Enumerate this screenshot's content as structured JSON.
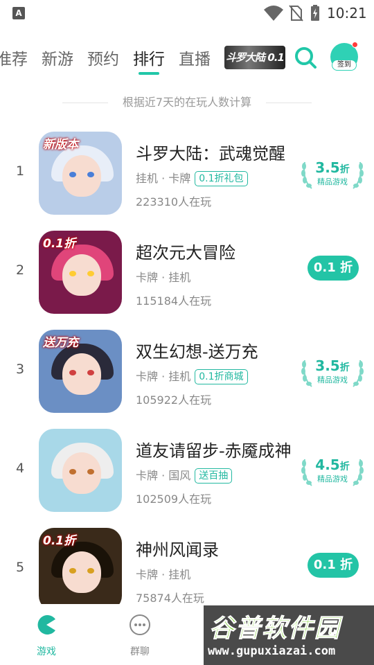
{
  "status_bar": {
    "app_indicator": "A",
    "time": "10:21"
  },
  "tabs": [
    {
      "label": "推荐",
      "partial": "准荐"
    },
    {
      "label": "新游"
    },
    {
      "label": "预约"
    },
    {
      "label": "排行",
      "active": true
    },
    {
      "label": "直播"
    }
  ],
  "tab_banner": {
    "text": "斗罗大陆 0.1"
  },
  "signin": {
    "label": "签到"
  },
  "note": "根据近7天的在玩人数计算",
  "games": [
    {
      "rank": "1",
      "title": "斗罗大陆：武魂觉醒",
      "categories": "挂机 · 卡牌",
      "chip": "0.1折礼包",
      "players": "223310人在玩",
      "icon_tag": "新版本",
      "discount_type": "laurel",
      "discount_value": "3.5",
      "discount_unit": "折",
      "discount_sub": "精品游戏",
      "icon_colors": {
        "bg": "#b9cde8",
        "hair": "#e8eef8",
        "eye": "#4a7fd8"
      }
    },
    {
      "rank": "2",
      "title": "超次元大冒险",
      "categories": "卡牌 · 挂机",
      "chip": "",
      "players": "115184人在玩",
      "icon_tag": "0.1折",
      "discount_type": "pill",
      "discount_value": "0.1",
      "discount_unit": "折",
      "icon_colors": {
        "bg": "#7a1a4a",
        "hair": "#e0457a",
        "eye": "#ffcc33"
      }
    },
    {
      "rank": "3",
      "title": "双生幻想-送万充",
      "categories": "卡牌 · 挂机",
      "chip": "0.1折商城",
      "players": "105922人在玩",
      "icon_tag": "送万充",
      "discount_type": "laurel",
      "discount_value": "3.5",
      "discount_unit": "折",
      "discount_sub": "精品游戏",
      "icon_colors": {
        "bg": "#6b8fc4",
        "hair": "#2a2a3a",
        "eye": "#d04040"
      }
    },
    {
      "rank": "4",
      "title": "道友请留步-赤魇成神",
      "categories": "卡牌 · 国风",
      "chip": "送百抽",
      "players": "102509人在玩",
      "icon_tag": "",
      "discount_type": "laurel",
      "discount_value": "4.5",
      "discount_unit": "折",
      "discount_sub": "精品游戏",
      "icon_colors": {
        "bg": "#a8d8e8",
        "hair": "#eeeeee",
        "eye": "#c07030"
      }
    },
    {
      "rank": "5",
      "title": "神州风闻录",
      "categories": "卡牌 · 挂机",
      "chip": "",
      "players": "75874人在玩",
      "icon_tag": "0.1折",
      "discount_type": "pill",
      "discount_value": "0.1",
      "discount_unit": "折",
      "icon_colors": {
        "bg": "#3a2a1a",
        "hair": "#1a1208",
        "eye": "#d8a020"
      }
    }
  ],
  "bottom_nav": [
    {
      "label": "游戏",
      "icon": "pacman-icon",
      "active": true
    },
    {
      "label": "群聊",
      "icon": "chat-bubble-icon",
      "active": false
    }
  ],
  "watermark": {
    "title": "谷普软件园",
    "url": "www.gupuxiazai.com"
  },
  "colors": {
    "accent": "#21b8a0",
    "accent_fill": "#23c4a6"
  }
}
